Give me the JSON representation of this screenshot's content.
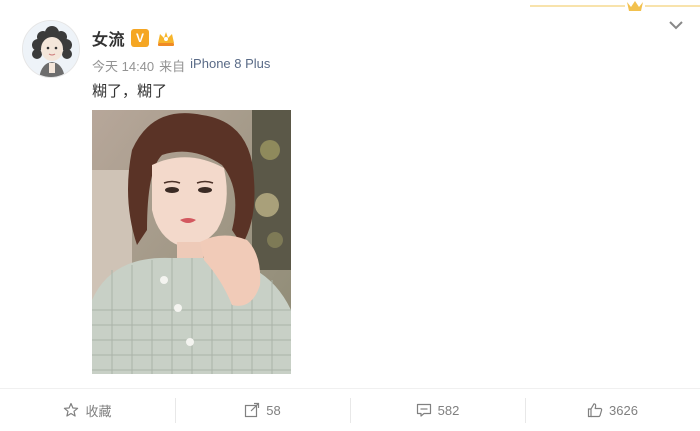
{
  "post": {
    "author_name": "女流",
    "verified_badge": "V",
    "timestamp": "今天 14:40",
    "source_prefix": "来自",
    "device": "iPhone 8 Plus",
    "text": "糊了，糊了"
  },
  "actions": {
    "favorite_label": "收藏",
    "repost_count": "58",
    "comment_count": "582",
    "like_count": "3626"
  },
  "icons": {
    "collapse": "chevron-down-icon",
    "favorite": "star-icon",
    "repost": "share-icon",
    "comment": "comment-icon",
    "like": "thumbs-up-icon"
  },
  "colors": {
    "vip_badge": "#f5a623",
    "member_badge": "#f7b52b",
    "link": "#5a6b87",
    "meta": "#939393"
  }
}
